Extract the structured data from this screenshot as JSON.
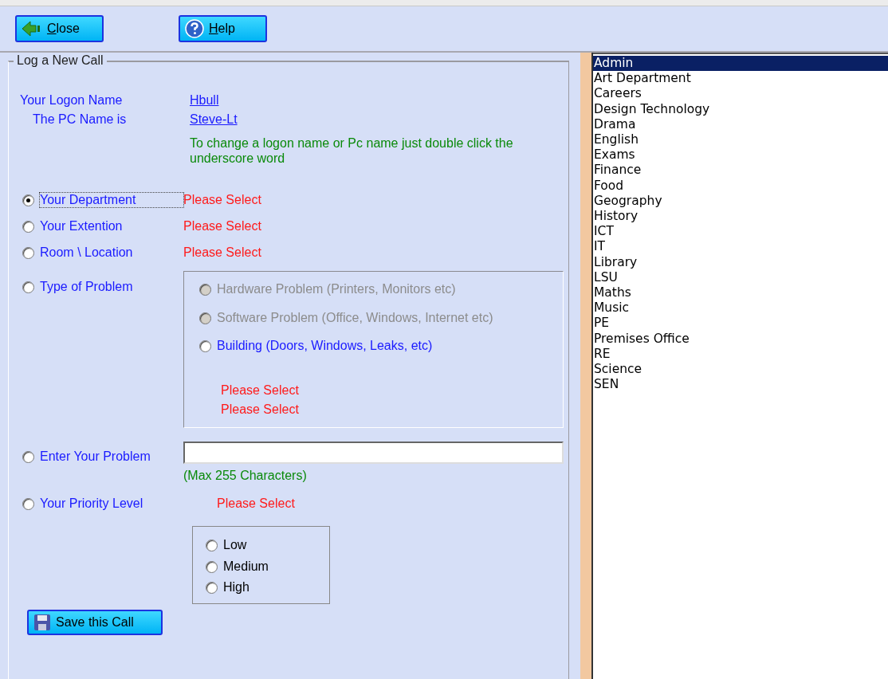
{
  "toolbar": {
    "buttons": [
      {
        "kind": "close",
        "label": "Close"
      },
      {
        "kind": "help",
        "label": "Help"
      }
    ]
  },
  "form": {
    "legend": "Log a New Call",
    "logon": {
      "label": "Your Logon Name",
      "value": "Hbull"
    },
    "pc": {
      "label": "The PC Name is",
      "value": "Steve-Lt"
    },
    "hint": "To change a logon name or Pc name just double click the underscore word",
    "options": [
      {
        "label": "Your Department",
        "selected": true,
        "status": "Please Select"
      },
      {
        "label": "Your Extention",
        "selected": false,
        "status": "Please Select"
      },
      {
        "label": "Room \\ Location",
        "selected": false,
        "status": "Please Select"
      },
      {
        "label": "Type of Problem",
        "selected": false
      }
    ],
    "problem_types": [
      {
        "label": "Hardware Problem (Printers, Monitors etc)",
        "selected": false,
        "disabled": true
      },
      {
        "label": "Software Problem (Office, Windows, Internet etc)",
        "selected": false,
        "disabled": true
      },
      {
        "label": "Building (Doors, Windows, Leaks, etc)",
        "selected": false,
        "disabled": false
      }
    ],
    "problem_status": [
      "Please Select",
      "Please Select"
    ],
    "enter_problem": {
      "label": "Enter Your Problem",
      "selected": false,
      "note": "(Max 255 Characters)"
    },
    "priority": {
      "label": "Your Priority Level",
      "selected": false,
      "status": "Please Select",
      "levels": [
        {
          "label": "Low",
          "selected": false
        },
        {
          "label": "Medium",
          "selected": false
        },
        {
          "label": "High",
          "selected": false
        }
      ]
    },
    "save_button": "Save this Call"
  },
  "departments": [
    {
      "label": "Admin",
      "selected": true
    },
    {
      "label": "Art Department",
      "selected": false
    },
    {
      "label": "Careers",
      "selected": false
    },
    {
      "label": "Design Technology",
      "selected": false
    },
    {
      "label": "Drama",
      "selected": false
    },
    {
      "label": "English",
      "selected": false
    },
    {
      "label": "Exams",
      "selected": false
    },
    {
      "label": "Finance",
      "selected": false
    },
    {
      "label": "Food",
      "selected": false
    },
    {
      "label": "Geography",
      "selected": false
    },
    {
      "label": "History",
      "selected": false
    },
    {
      "label": "ICT",
      "selected": false
    },
    {
      "label": "IT",
      "selected": false
    },
    {
      "label": "Library",
      "selected": false
    },
    {
      "label": "LSU",
      "selected": false
    },
    {
      "label": "Maths",
      "selected": false
    },
    {
      "label": "Music",
      "selected": false
    },
    {
      "label": "PE",
      "selected": false
    },
    {
      "label": "Premises Office",
      "selected": false
    },
    {
      "label": "RE",
      "selected": false
    },
    {
      "label": "Science",
      "selected": false
    },
    {
      "label": "SEN",
      "selected": false
    }
  ]
}
